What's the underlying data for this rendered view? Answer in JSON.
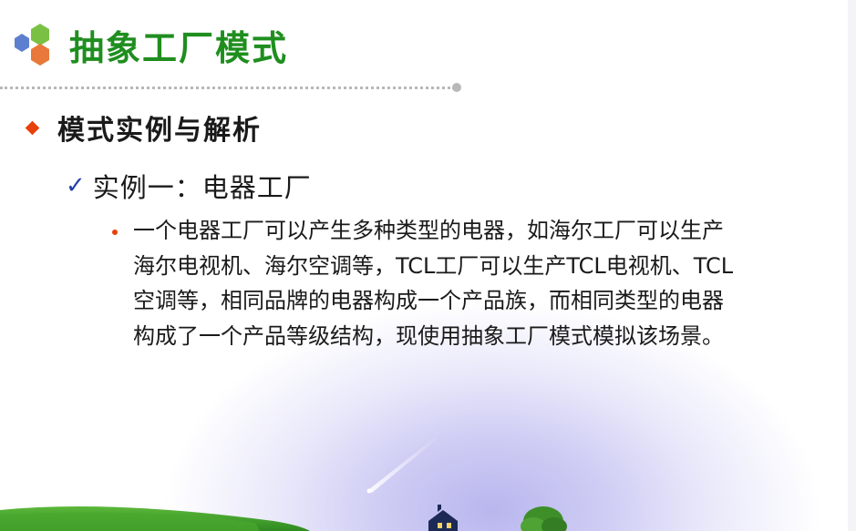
{
  "slide": {
    "title": "抽象工厂模式",
    "section_heading": "模式实例与解析",
    "example_heading": "实例一：电器工厂",
    "check_glyph": "✓",
    "description_lines": [
      "一个电器工厂可以产生多种类型的电器，如海尔工厂可以生产",
      "海尔电视机、海尔空调等，TCL工厂可以生产TCL电视机、TCL",
      "空调等，相同品牌的电器构成一个产品族，而相同类型的电器",
      "构成了一个产品等级结构，现使用抽象工厂模式模拟该场景。"
    ]
  },
  "colors": {
    "title_green": "#1f8e1f",
    "bullet_orange": "#e8400c",
    "check_blue": "#2540a8",
    "logo_blue": "#5d7fcf",
    "logo_green": "#7ac143",
    "logo_orange": "#e8793a",
    "hill_green": "#3c9a2a"
  },
  "icons": {
    "logo": "hexagon-cluster-logo",
    "level1_bullet": "diamond-bullet-icon",
    "level2_bullet": "checkmark-icon",
    "level3_bullet": "dot-bullet-icon"
  }
}
